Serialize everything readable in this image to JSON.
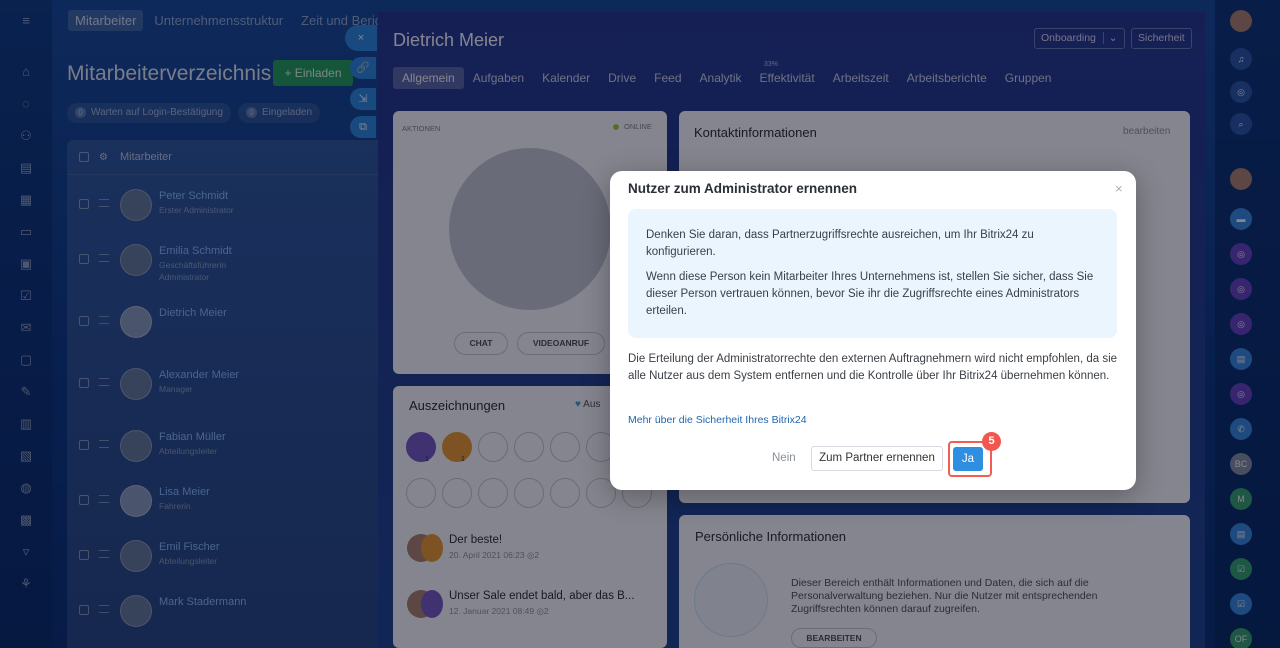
{
  "background": {
    "tabs": [
      "Mitarbeiter",
      "Unternehmensstruktur",
      "Zeit und Berichte"
    ],
    "title": "Mitarbeiterverzeichnis",
    "invite_label": "+ Einladen",
    "filters": [
      {
        "count": "0",
        "label": "Warten auf Login-Bestätigung"
      },
      {
        "count": "0",
        "label": "Eingeladen"
      }
    ],
    "column_header": "Mitarbeiter",
    "employees": [
      {
        "name": "Peter Schmidt",
        "position": "Erster Administrator"
      },
      {
        "name": "Emilia Schmidt",
        "position": "Geschäftsführerin\nAdministrator"
      },
      {
        "name": "Dietrich Meier",
        "position": ""
      },
      {
        "name": "Alexander Meier",
        "position": "Manager"
      },
      {
        "name": "Fabian Müller",
        "position": "Abteilungsleiter"
      },
      {
        "name": "Lisa Meier",
        "position": "Fahrerin"
      },
      {
        "name": "Emil Fischer",
        "position": "Abteilungsleiter"
      },
      {
        "name": "Mark Stadermann",
        "position": ""
      }
    ]
  },
  "slider_tools": {
    "close": "×",
    "link": "🔗",
    "minimize": "⇲",
    "new_window": "⧉"
  },
  "profile": {
    "name": "Dietrich Meier",
    "onboarding_label": "Onboarding",
    "security_label": "Sicherheit",
    "efficiency_percent": "33%",
    "tabs": [
      "Allgemein",
      "Aufgaben",
      "Kalender",
      "Drive",
      "Feed",
      "Analytik",
      "Effektivität",
      "Arbeitszeit",
      "Arbeitsberichte",
      "Gruppen"
    ],
    "actions_label": "AKTIONEN",
    "status": "ONLINE",
    "chat_label": "CHAT",
    "video_label": "VIDEOANRUF",
    "contact_title": "Kontaktinformationen",
    "edit_label": "bearbeiten",
    "awards_title": "Auszeichnungen",
    "awards_like": "Aus",
    "award_counts": [
      "1",
      "1"
    ],
    "feed": [
      {
        "title": "Der beste!",
        "meta": "20. April 2021 06:23",
        "views": "2"
      },
      {
        "title": "Unser Sale endet bald, aber das B...",
        "meta": "12. Januar 2021 08:49",
        "views": "2"
      }
    ],
    "personal_title": "Persönliche Informationen",
    "personal_text": "Dieser Bereich enthält Informationen und Daten, die sich auf die Personalverwaltung beziehen. Nur die Nutzer mit entsprechenden Zugriffsrechten können darauf zugreifen.",
    "personal_edit_label": "BEARBEITEN"
  },
  "right_nav": {
    "initials": [
      "BC",
      "M",
      "OF"
    ]
  },
  "modal": {
    "title": "Nutzer zum Administrator ernennen",
    "close": "×",
    "info_p1": "Denken Sie daran, dass Partnerzugriffsrechte ausreichen, um Ihr Bitrix24 zu konfigurieren.",
    "info_p2": "Wenn diese Person kein Mitarbeiter Ihres Unternehmens ist, stellen Sie sicher, dass Sie dieser Person vertrauen können, bevor Sie ihr die Zugriffsrechte eines Administrators erteilen.",
    "warning": "Die Erteilung der Administratorrechte den externen Auftragnehmern wird nicht empfohlen, da sie alle Nutzer aus dem System entfernen und die Kontrolle über Ihr Bitrix24 übernehmen können.",
    "link": "Mehr über die Sicherheit Ihres Bitrix24",
    "no_label": "Nein",
    "partner_label": "Zum Partner ernennen",
    "yes_label": "Ja",
    "step_number": "5"
  },
  "colors": {
    "accent": "#2f8ee0",
    "highlight": "#f25c54",
    "invite": "#2aa55d"
  }
}
